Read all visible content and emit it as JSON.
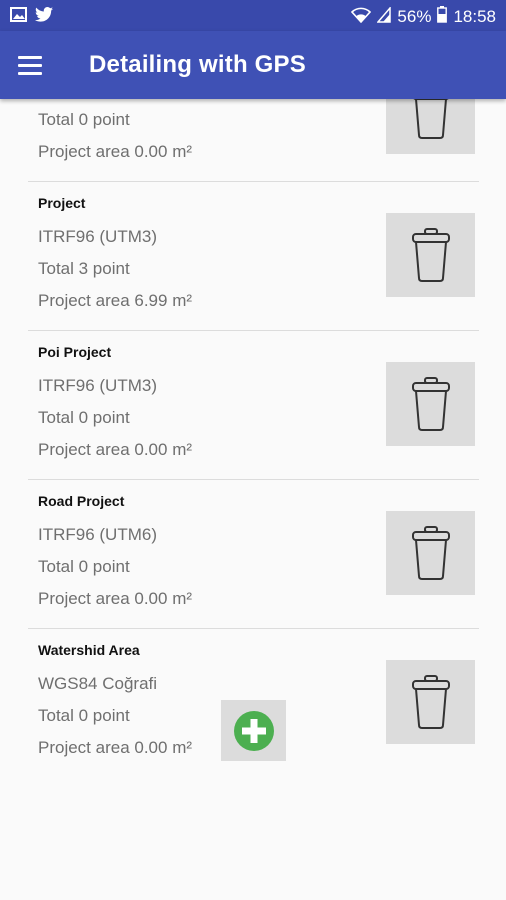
{
  "status_bar": {
    "battery": "56%",
    "time": "18:58",
    "icons": [
      "image-icon",
      "twitter-icon",
      "wifi-icon",
      "signal-icon",
      "battery-icon"
    ]
  },
  "app_bar": {
    "title": "Detailing with GPS",
    "menu_icon": "menu-icon"
  },
  "projects": [
    {
      "name": "",
      "system": "",
      "total": "Total 0 point",
      "area": "Project area 0.00 m²"
    },
    {
      "name": "Project",
      "system": "ITRF96 (UTM3)",
      "total": "Total 3 point",
      "area": "Project area 6.99 m²"
    },
    {
      "name": "Poi Project",
      "system": "ITRF96 (UTM3)",
      "total": "Total 0 point",
      "area": "Project area 0.00 m²"
    },
    {
      "name": "Road Project",
      "system": "ITRF96 (UTM6)",
      "total": "Total 0 point",
      "area": "Project area 0.00 m²"
    },
    {
      "name": "Watershid Area",
      "system": "WGS84 Coğrafi",
      "total": "Total 0 point",
      "area": "Project area 0.00 m²"
    }
  ],
  "colors": {
    "status_bar": "#3949ab",
    "app_bar": "#3f51b5",
    "add_icon": "#4caf50",
    "tile": "#dcdcdc"
  }
}
